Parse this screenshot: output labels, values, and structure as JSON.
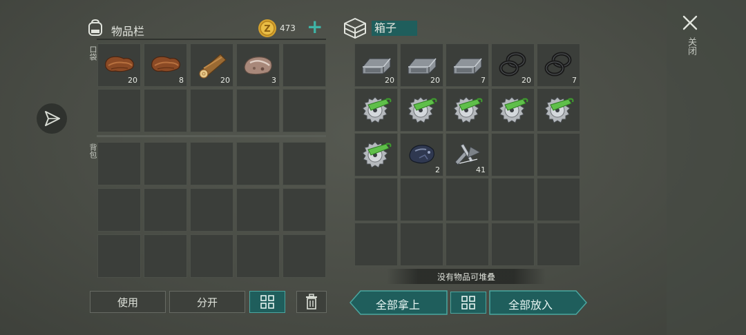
{
  "inventory": {
    "title": "物品栏",
    "coins": "473",
    "add_symbol": "+",
    "pocket_label": "口袋",
    "backpack_label": "背包",
    "pocket_items": [
      {
        "icon": "leather-icon",
        "qty": "20"
      },
      {
        "icon": "leather-icon",
        "qty": "8"
      },
      {
        "icon": "wood-log-icon",
        "qty": "20"
      },
      {
        "icon": "stone-ore-icon",
        "qty": "3"
      }
    ]
  },
  "box": {
    "title": "箱子",
    "items": [
      {
        "icon": "iron-bar-icon",
        "qty": "20"
      },
      {
        "icon": "iron-bar-icon",
        "qty": "20"
      },
      {
        "icon": "iron-bar-icon",
        "qty": "7"
      },
      {
        "icon": "rubber-ring-icon",
        "qty": "20"
      },
      {
        "icon": "rubber-ring-icon",
        "qty": "7"
      },
      {
        "icon": "saw-blade-icon",
        "qty": ""
      },
      {
        "icon": "saw-blade-icon",
        "qty": ""
      },
      {
        "icon": "saw-blade-icon",
        "qty": ""
      },
      {
        "icon": "saw-blade-icon",
        "qty": ""
      },
      {
        "icon": "saw-blade-icon",
        "qty": ""
      },
      {
        "icon": "saw-blade-icon",
        "qty": ""
      },
      {
        "icon": "dark-ore-icon",
        "qty": "2"
      },
      {
        "icon": "metal-scrap-icon",
        "qty": "41"
      }
    ]
  },
  "close_label": "关闭",
  "hint": "没有物品可堆叠",
  "buttons": {
    "use": "使用",
    "split": "分开",
    "take_all": "全部拿上",
    "put_all": "全部放入"
  },
  "colors": {
    "teal": "#1f5e5c",
    "teal_border": "#4aa7a0",
    "plus": "#3fb4a6"
  }
}
